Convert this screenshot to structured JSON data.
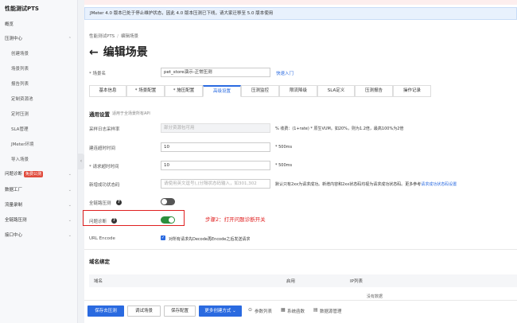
{
  "sidebar": {
    "title": "性能测试PTS",
    "items": [
      {
        "label": "概览"
      },
      {
        "label": "压测中心"
      },
      {
        "label": "创建场景"
      },
      {
        "label": "场景列表"
      },
      {
        "label": "报告列表"
      },
      {
        "label": "定制资源池"
      },
      {
        "label": "定时压测"
      },
      {
        "label": "SLA管理"
      },
      {
        "label": "JMeter环境"
      },
      {
        "label": "导入场景"
      },
      {
        "label": "问题诊断",
        "badge": "免费公测"
      },
      {
        "label": "数据工厂"
      },
      {
        "label": "流量录制"
      },
      {
        "label": "全链路压测"
      },
      {
        "label": "接口中心"
      }
    ]
  },
  "banner": {
    "text": "JMeter 4.0 版本已处于停止维护状态，因此 4.0 版本压测已下线，请大家迁移至 5.0 版本使用"
  },
  "breadcrumb": {
    "root": "性能测试PTS",
    "sep": "/",
    "current": "编辑场景"
  },
  "page": {
    "back": "←",
    "title": "编辑场景"
  },
  "scene": {
    "label": "* 场景名",
    "value": "pet_store演示-正常压测",
    "quickstart": "快速入门"
  },
  "tabs": [
    {
      "label": "基本信息"
    },
    {
      "label": "* 场景配置"
    },
    {
      "label": "* 施压配置"
    },
    {
      "label": "高级设置"
    },
    {
      "label": "压测监控"
    },
    {
      "label": "限流降级"
    },
    {
      "label": "SLA定义"
    },
    {
      "label": "压测报告"
    },
    {
      "label": "操作记录"
    }
  ],
  "general": {
    "title": "通用设置",
    "subtitle": "适用于全场景所有API"
  },
  "sampling": {
    "label": "采样日志采样率",
    "placeholder": "部分资源包可用",
    "hint": "% 收费：(1+rate) * 原生VUM。如20%，则为1.2倍，最高100%为2倍"
  },
  "connect_timeout": {
    "label": "建连超时时间",
    "value": "10",
    "unit": "* 500ms"
  },
  "request_timeout": {
    "label": "* 请求超时时间",
    "value": "10",
    "unit": "* 500ms"
  },
  "success_code": {
    "label": "新增成功状态码",
    "placeholder": "请使用英文逗号(,)分隔状态码输入，如301,302",
    "hint": "默认只有2xx为请求成功。新增内容和2xx状态码均视为请求成功状态码。更多参考",
    "link": "请求成功状态码设置"
  },
  "fulllink": {
    "label": "全链路压测",
    "help": "?",
    "enabled": false
  },
  "diagnosis": {
    "label": "问题诊断",
    "help": "?",
    "enabled": true
  },
  "annotation": "步骤2：打开问题诊断开关",
  "url_encode": {
    "label": "URL Encode",
    "checked": true,
    "check_glyph": "✓",
    "text": "对所有请求先Decode再Encode之后发送请求"
  },
  "domain_binding": {
    "title": "域名绑定",
    "columns": [
      "域名",
      "启用",
      "IP列表"
    ],
    "empty": "没有数据"
  },
  "footer": {
    "save_run": "保存去压测",
    "debug": "调试场景",
    "save": "保存配置",
    "more": "更多创建方式",
    "more_caret": "⌄",
    "params_icon": "⊙",
    "params": "参数列表",
    "sysfunc_icon": "▦",
    "sysfunc": "系统函数",
    "datasource_icon": "▤",
    "datasource": "数据源管理"
  },
  "colors": {
    "accent": "#2a6ae0",
    "toggle_on": "#2d8f3d",
    "annotation": "#e02020"
  }
}
